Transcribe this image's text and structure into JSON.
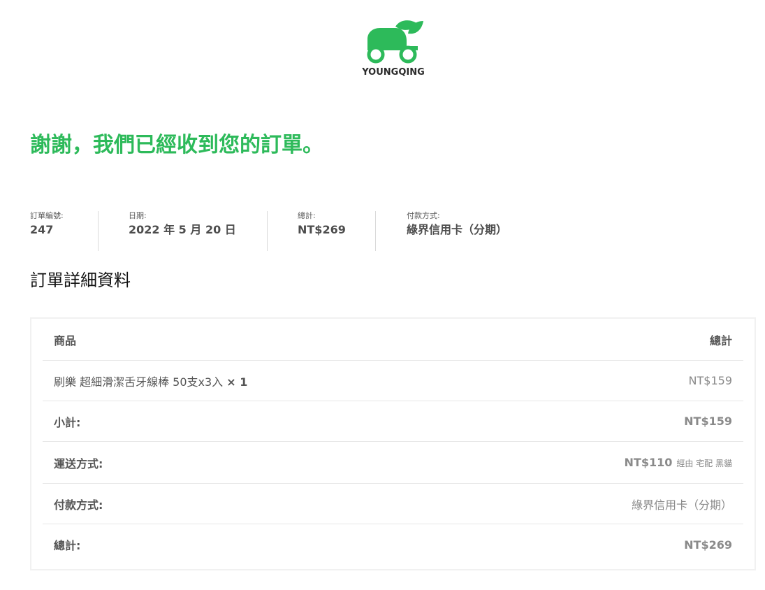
{
  "brand": {
    "name": "YOUNGQING",
    "green": "#2dba5a"
  },
  "thanks_message": "謝謝，我們已經收到您的訂單。",
  "overview": {
    "order_number_label": "訂單編號:",
    "order_number": "247",
    "date_label": "日期:",
    "date": "2022 年 5 月 20 日",
    "total_label": "總計:",
    "total": "NT$269",
    "payment_label": "付款方式:",
    "payment": "綠界信用卡（分期）"
  },
  "details": {
    "title": "訂單詳細資料",
    "header_product": "商品",
    "header_total": "總計",
    "item": {
      "name": "刷樂 超細滑潔舌牙線棒 50支x3入",
      "qty": "× 1",
      "price": "NT$159"
    },
    "subtotal_label": "小計:",
    "subtotal": "NT$159",
    "shipping_label": "運送方式:",
    "shipping_price": "NT$110",
    "shipping_via": "經由 宅配 黑貓",
    "payment_label": "付款方式:",
    "payment": "綠界信用卡（分期）",
    "total_label": "總計:",
    "total": "NT$269"
  }
}
